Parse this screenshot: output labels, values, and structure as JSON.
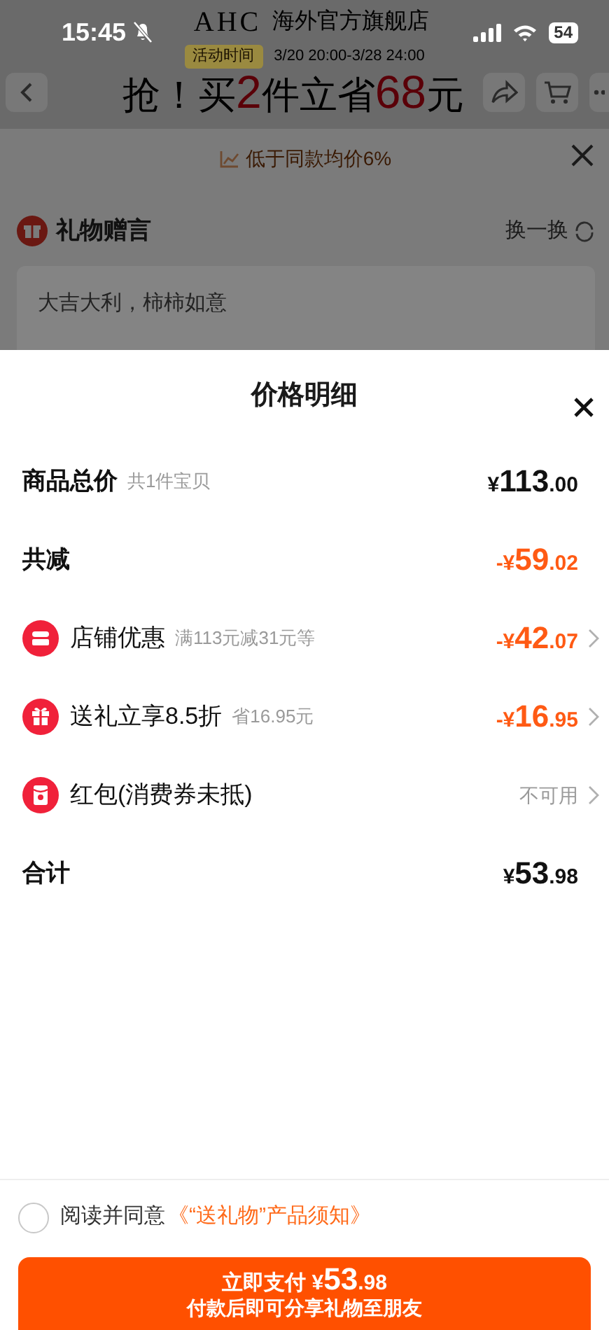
{
  "status_bar": {
    "time": "15:45",
    "muted": true,
    "battery": "54"
  },
  "background_page": {
    "brand": "AHC",
    "store": "海外官方旗舰店",
    "activity_label": "活动时间",
    "activity_time": "3/20 20:00-3/28 24:00",
    "headline": [
      {
        "text": "抢！买",
        "highlight": false
      },
      {
        "text": "2",
        "highlight": true
      },
      {
        "text": "件立省",
        "highlight": false
      },
      {
        "text": "68",
        "highlight": true
      },
      {
        "text": "元",
        "highlight": false
      }
    ],
    "price_note": "低于同款均价6%",
    "gift_message_title": "礼物赠言",
    "change_label": "换一换",
    "gift_message": "大吉大利，柿柿如意"
  },
  "sheet": {
    "title": "价格明细",
    "rows": [
      {
        "kind": "plain",
        "label": "商品总价",
        "note": "共1件宝贝",
        "discount": false,
        "amount": {
          "prefix": "¥",
          "integer": "113",
          "decimal": ".00"
        }
      },
      {
        "kind": "plain",
        "label": "共减",
        "discount": true,
        "amount": {
          "prefix": "-¥",
          "integer": "59",
          "decimal": ".02"
        }
      },
      {
        "kind": "store",
        "label": "店铺优惠",
        "note": "满113元减31元等",
        "discount": true,
        "amount": {
          "prefix": "-¥",
          "integer": "42",
          "decimal": ".07"
        }
      },
      {
        "kind": "gift",
        "label": "送礼立享8.5折",
        "note": "省16.95元",
        "discount": true,
        "amount": {
          "prefix": "-¥",
          "integer": "16",
          "decimal": ".95"
        }
      },
      {
        "kind": "red-packet",
        "label": "红包(消费券未抵)",
        "status": "不可用"
      },
      {
        "kind": "plain",
        "label": "合计",
        "discount": false,
        "amount": {
          "prefix": "¥",
          "integer": "53",
          "decimal": ".98"
        }
      }
    ],
    "agreement": {
      "checked": false,
      "text": "阅读并同意",
      "link": "《“送礼物”产品须知》"
    },
    "pay_button": {
      "label": "立即支付",
      "amount": {
        "prefix": "¥",
        "integer": "53",
        "decimal": ".98"
      },
      "subtitle": "付款后即可分享礼物至朋友"
    }
  }
}
